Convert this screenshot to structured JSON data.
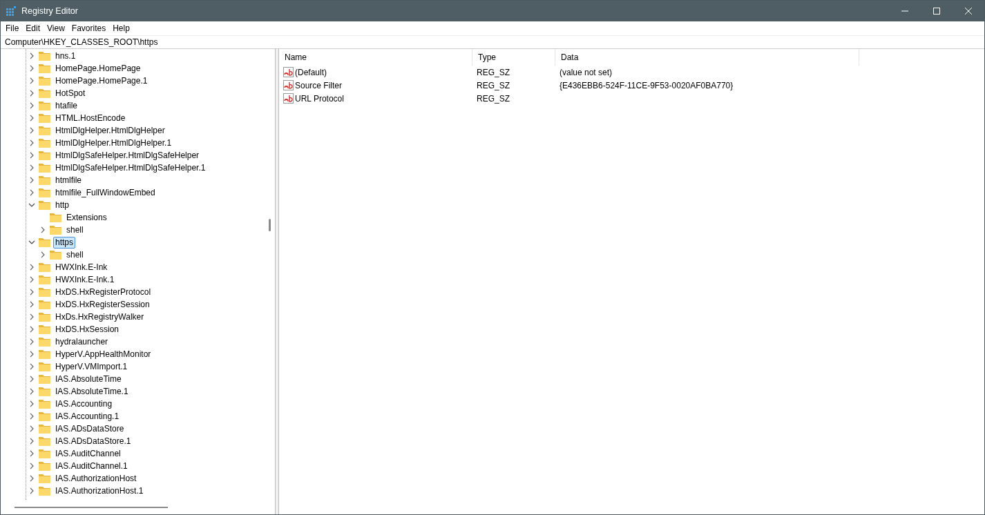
{
  "window": {
    "title": "Registry Editor"
  },
  "menu": [
    "File",
    "Edit",
    "View",
    "Favorites",
    "Help"
  ],
  "address": "Computer\\HKEY_CLASSES_ROOT\\https",
  "tree": [
    {
      "label": "hns.1",
      "expandable": true,
      "expanded": false,
      "selected": false
    },
    {
      "label": "HomePage.HomePage",
      "expandable": true,
      "expanded": false,
      "selected": false
    },
    {
      "label": "HomePage.HomePage.1",
      "expandable": true,
      "expanded": false,
      "selected": false
    },
    {
      "label": "HotSpot",
      "expandable": true,
      "expanded": false,
      "selected": false
    },
    {
      "label": "htafile",
      "expandable": true,
      "expanded": false,
      "selected": false
    },
    {
      "label": "HTML.HostEncode",
      "expandable": true,
      "expanded": false,
      "selected": false
    },
    {
      "label": "HtmlDlgHelper.HtmlDlgHelper",
      "expandable": true,
      "expanded": false,
      "selected": false
    },
    {
      "label": "HtmlDlgHelper.HtmlDlgHelper.1",
      "expandable": true,
      "expanded": false,
      "selected": false
    },
    {
      "label": "HtmlDlgSafeHelper.HtmlDlgSafeHelper",
      "expandable": true,
      "expanded": false,
      "selected": false
    },
    {
      "label": "HtmlDlgSafeHelper.HtmlDlgSafeHelper.1",
      "expandable": true,
      "expanded": false,
      "selected": false
    },
    {
      "label": "htmlfile",
      "expandable": true,
      "expanded": false,
      "selected": false
    },
    {
      "label": "htmlfile_FullWindowEmbed",
      "expandable": true,
      "expanded": false,
      "selected": false
    },
    {
      "label": "http",
      "expandable": true,
      "expanded": true,
      "selected": false,
      "children": [
        {
          "label": "Extensions",
          "expandable": false,
          "selected": false
        },
        {
          "label": "shell",
          "expandable": true,
          "expanded": false,
          "selected": false
        }
      ]
    },
    {
      "label": "https",
      "expandable": true,
      "expanded": true,
      "selected": true,
      "children": [
        {
          "label": "shell",
          "expandable": true,
          "expanded": false,
          "selected": false
        }
      ]
    },
    {
      "label": "HWXInk.E-Ink",
      "expandable": true,
      "expanded": false,
      "selected": false
    },
    {
      "label": "HWXInk.E-Ink.1",
      "expandable": true,
      "expanded": false,
      "selected": false
    },
    {
      "label": "HxDS.HxRegisterProtocol",
      "expandable": true,
      "expanded": false,
      "selected": false
    },
    {
      "label": "HxDS.HxRegisterSession",
      "expandable": true,
      "expanded": false,
      "selected": false
    },
    {
      "label": "HxDs.HxRegistryWalker",
      "expandable": true,
      "expanded": false,
      "selected": false
    },
    {
      "label": "HxDS.HxSession",
      "expandable": true,
      "expanded": false,
      "selected": false
    },
    {
      "label": "hydralauncher",
      "expandable": true,
      "expanded": false,
      "selected": false
    },
    {
      "label": "HyperV.AppHealthMonitor",
      "expandable": true,
      "expanded": false,
      "selected": false
    },
    {
      "label": "HyperV.VMImport.1",
      "expandable": true,
      "expanded": false,
      "selected": false
    },
    {
      "label": "IAS.AbsoluteTime",
      "expandable": true,
      "expanded": false,
      "selected": false
    },
    {
      "label": "IAS.AbsoluteTime.1",
      "expandable": true,
      "expanded": false,
      "selected": false
    },
    {
      "label": "IAS.Accounting",
      "expandable": true,
      "expanded": false,
      "selected": false
    },
    {
      "label": "IAS.Accounting.1",
      "expandable": true,
      "expanded": false,
      "selected": false
    },
    {
      "label": "IAS.ADsDataStore",
      "expandable": true,
      "expanded": false,
      "selected": false
    },
    {
      "label": "IAS.ADsDataStore.1",
      "expandable": true,
      "expanded": false,
      "selected": false
    },
    {
      "label": "IAS.AuditChannel",
      "expandable": true,
      "expanded": false,
      "selected": false
    },
    {
      "label": "IAS.AuditChannel.1",
      "expandable": true,
      "expanded": false,
      "selected": false
    },
    {
      "label": "IAS.AuthorizationHost",
      "expandable": true,
      "expanded": false,
      "selected": false
    },
    {
      "label": "IAS.AuthorizationHost.1",
      "expandable": true,
      "expanded": false,
      "selected": false
    }
  ],
  "values": {
    "columns": [
      "Name",
      "Type",
      "Data"
    ],
    "rows": [
      {
        "name": "(Default)",
        "type": "REG_SZ",
        "data": "(value not set)"
      },
      {
        "name": "Source Filter",
        "type": "REG_SZ",
        "data": "{E436EBB6-524F-11CE-9F53-0020AF0BA770}"
      },
      {
        "name": "URL Protocol",
        "type": "REG_SZ"
      }
    ]
  }
}
